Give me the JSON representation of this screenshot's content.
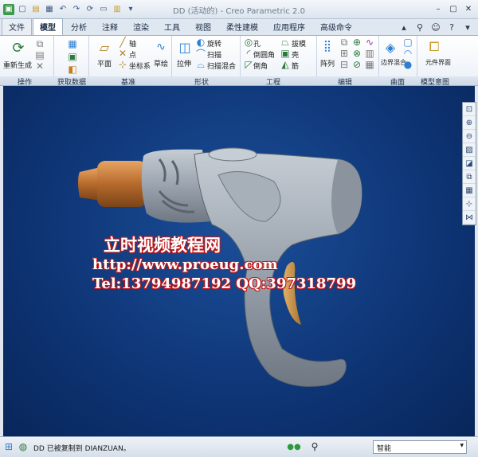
{
  "window": {
    "title": "DD (活动的) - Creo Parametric 2.0"
  },
  "quick_access": [
    "new-icon",
    "open-icon",
    "save-icon",
    "undo-icon",
    "redo-icon",
    "regenerate-icon",
    "window-icon",
    "close-window-icon",
    "customize-icon"
  ],
  "tabs": [
    {
      "label": "文件",
      "type": "file"
    },
    {
      "label": "模型",
      "active": true
    },
    {
      "label": "分析"
    },
    {
      "label": "注释"
    },
    {
      "label": "渲染"
    },
    {
      "label": "工具"
    },
    {
      "label": "视图"
    },
    {
      "label": "柔性建模"
    },
    {
      "label": "应用程序"
    },
    {
      "label": "高级命令"
    }
  ],
  "ribbon": {
    "operations": {
      "regenerate_label": "重新生成",
      "group": "操作"
    },
    "get_data": {
      "group": "获取数据"
    },
    "datum": {
      "plane": "平面",
      "axis": "轴",
      "point": "点",
      "csys": "坐标系",
      "sketch": "草绘",
      "group": "基准"
    },
    "shapes": {
      "extrude": "拉伸",
      "revolve": "旋转",
      "sweep": "扫描",
      "swept_blend": "扫描混合",
      "group": "形状"
    },
    "engineering": {
      "hole": "孔",
      "round": "倒圆角",
      "chamfer": "倒角",
      "draft": "拔模",
      "shell": "壳",
      "rib": "筋",
      "group": "工程"
    },
    "editing": {
      "pattern": "阵列",
      "group": "编辑"
    },
    "surfaces": {
      "boundary_blend": "边界混合",
      "group": "曲面"
    },
    "model_intent": {
      "component_interface": "元件界面",
      "group": "模型意图"
    }
  },
  "watermark": {
    "line1": "立时视频教程网",
    "line2": "http://www.proeug.com",
    "line3": "Tel:13794987192  QQ:397318799"
  },
  "status": {
    "message": "DD 已被复制到 DIANZUAN。",
    "filter": "智能"
  },
  "colors": {
    "viewport": "#0e3474",
    "gun_body": "#9aa3ad",
    "nozzle": "#b76a2c",
    "watermark_outline": "#c0181b"
  }
}
